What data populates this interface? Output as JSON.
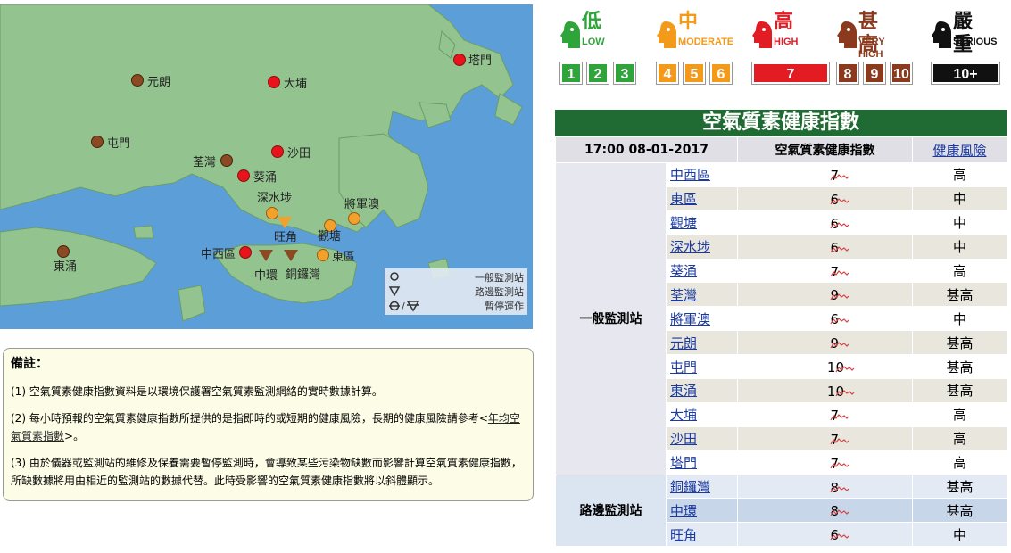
{
  "map": {
    "stations": [
      {
        "id": "tap-mun",
        "label": "塔門",
        "color": "red"
      },
      {
        "id": "yuen-long",
        "label": "元朗",
        "color": "brown"
      },
      {
        "id": "tai-po",
        "label": "大埔",
        "color": "red"
      },
      {
        "id": "tuen-mun",
        "label": "屯門",
        "color": "brown"
      },
      {
        "id": "sha-tin",
        "label": "沙田",
        "color": "red"
      },
      {
        "id": "tsuen-wan",
        "label": "荃灣",
        "color": "brown"
      },
      {
        "id": "kwai-chung",
        "label": "葵涌",
        "color": "red"
      },
      {
        "id": "sham-shui-po",
        "label": "深水埗",
        "color": "orange"
      },
      {
        "id": "tseung-kwan-o",
        "label": "將軍澳",
        "color": "orange"
      },
      {
        "id": "kwun-tong",
        "label": "觀塘",
        "color": "orange"
      },
      {
        "id": "mong-kok",
        "label": "旺角",
        "color": "orange"
      },
      {
        "id": "central-western",
        "label": "中西區",
        "color": "red"
      },
      {
        "id": "eastern",
        "label": "東區",
        "color": "orange"
      },
      {
        "id": "tung-chung",
        "label": "東涌",
        "color": "brown"
      },
      {
        "id": "central",
        "label": "中環",
        "color": "brown"
      },
      {
        "id": "causeway-bay",
        "label": "銅鑼灣",
        "color": "brown"
      }
    ],
    "legend": {
      "general": "一般監測站",
      "roadside": "路邊監測站",
      "suspended": "暫停運作"
    }
  },
  "notes": {
    "title": "備註：",
    "n1": "(1) 空氣質素健康指數資料是以環境保護署空氣質素監測網絡的實時數據計算。",
    "n2a": "(2) 每小時預報的空氣質素健康指數所提供的是指即時的或短期的健康風險，長期的健康風險請參考<",
    "n2link": "年均空氣質素指數",
    "n2b": ">。",
    "n3": "(3) 由於儀器或監測站的維修及保養需要暫停監測時，會導致某些污染物缺數而影響計算空氣質素健康指數，所缺數據將用由相近的監測站的數據代替。此時受影響的空氣質素健康指數將以斜體顯示。"
  },
  "levels": [
    {
      "zh": "低",
      "en": "LOW",
      "color": "#2fa43a",
      "boxes": [
        "1",
        "2",
        "3"
      ]
    },
    {
      "zh": "中",
      "en": "MODERATE",
      "color": "#f49a1a",
      "boxes": [
        "4",
        "5",
        "6"
      ]
    },
    {
      "zh": "高",
      "en": "HIGH",
      "color": "#e31b23",
      "boxes": [
        "7"
      ]
    },
    {
      "zh": "甚高",
      "en": "VERY HIGH",
      "color": "#8b3a1e",
      "boxes": [
        "8",
        "9",
        "10"
      ]
    },
    {
      "zh": "嚴重",
      "en": "SERIOUS",
      "color": "#111111",
      "boxes": [
        "10+"
      ]
    }
  ],
  "table": {
    "title": "空氣質素健康指數",
    "time": "17:00 08-01-2017",
    "col_index": "空氣質素健康指數",
    "col_risk": "健康風險",
    "general_group": "一般監測站",
    "roadside_group": "路邊監測站",
    "general": [
      {
        "station": "中西區",
        "aqhi": "7",
        "risk": "高"
      },
      {
        "station": "東區",
        "aqhi": "6",
        "risk": "中"
      },
      {
        "station": "觀塘",
        "aqhi": "6",
        "risk": "中"
      },
      {
        "station": "深水埗",
        "aqhi": "6",
        "risk": "中"
      },
      {
        "station": "葵涌",
        "aqhi": "7",
        "risk": "高"
      },
      {
        "station": "荃灣",
        "aqhi": "9",
        "risk": "甚高"
      },
      {
        "station": "將軍澳",
        "aqhi": "6",
        "risk": "中"
      },
      {
        "station": "元朗",
        "aqhi": "9",
        "risk": "甚高"
      },
      {
        "station": "屯門",
        "aqhi": "10",
        "risk": "甚高"
      },
      {
        "station": "東涌",
        "aqhi": "10",
        "risk": "甚高"
      },
      {
        "station": "大埔",
        "aqhi": "7",
        "risk": "高"
      },
      {
        "station": "沙田",
        "aqhi": "7",
        "risk": "高"
      },
      {
        "station": "塔門",
        "aqhi": "7",
        "risk": "高"
      }
    ],
    "roadside": [
      {
        "station": "銅鑼灣",
        "aqhi": "8",
        "risk": "甚高"
      },
      {
        "station": "中環",
        "aqhi": "8",
        "risk": "甚高"
      },
      {
        "station": "旺角",
        "aqhi": "6",
        "risk": "中"
      }
    ]
  }
}
